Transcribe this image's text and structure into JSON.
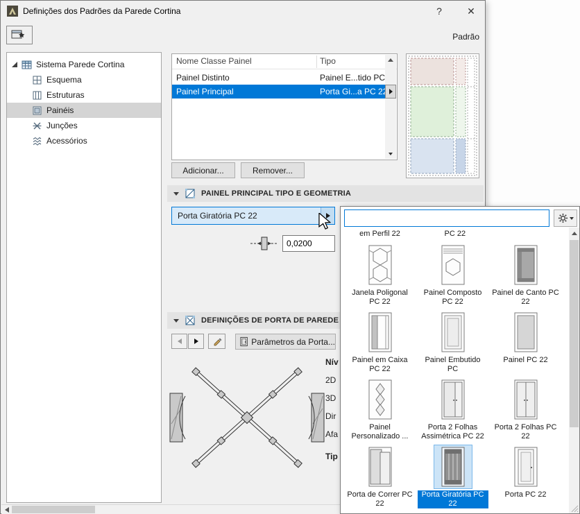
{
  "window": {
    "title": "Definições dos Padrões da Parede Cortina",
    "help_label": "?",
    "close_label": "✕"
  },
  "toolbar": {
    "state_label": "Padrão"
  },
  "sidebar": {
    "root_label": "Sistema Parede Cortina",
    "items": [
      {
        "label": "Esquema"
      },
      {
        "label": "Estruturas"
      },
      {
        "label": "Painéis"
      },
      {
        "label": "Junções"
      },
      {
        "label": "Acessórios"
      }
    ],
    "selected_item": "Painéis"
  },
  "panel_table": {
    "columns": {
      "name": "Nome Classe Painel",
      "type": "Tipo"
    },
    "rows": [
      {
        "name": "Painel Distinto",
        "type": "Painel E...tido PC"
      },
      {
        "name": "Painel Principal",
        "type": "Porta Gi...a PC 22"
      }
    ],
    "selected_row": "Painel Principal",
    "add_label": "Adicionar...",
    "remove_label": "Remover..."
  },
  "geometry_section": {
    "title": "PAINEL PRINCIPAL TIPO E GEOMETRIA",
    "type_value": "Porta Giratória PC 22",
    "thickness_value": "0,0200"
  },
  "door_section": {
    "title": "DEFINIÇÕES DE PORTA DE PAREDE CO",
    "params_button": "Parâmetros da Porta...",
    "clipped_labels": [
      "Nív",
      "2D",
      "3D",
      "Dir",
      "Afa",
      "Tip"
    ]
  },
  "popup": {
    "search_value": "",
    "partial_labels": [
      "em Perfil 22",
      "PC 22"
    ],
    "items": [
      {
        "label": "Janela Poligonal PC 22"
      },
      {
        "label": "Painel Composto PC 22"
      },
      {
        "label": "Painel de Canto PC 22"
      },
      {
        "label": "Painel em Caixa PC 22"
      },
      {
        "label": "Painel Embutido PC"
      },
      {
        "label": "Painel PC 22"
      },
      {
        "label": "Painel Personalizado ..."
      },
      {
        "label": "Porta 2 Folhas Assimétrica PC 22"
      },
      {
        "label": "Porta 2 Folhas PC 22"
      },
      {
        "label": "Porta de Correr PC 22"
      },
      {
        "label": "Porta Giratória PC 22"
      },
      {
        "label": "Porta PC 22"
      }
    ],
    "selected_item": "Porta Giratória PC 22",
    "selected_index": 10
  },
  "colors": {
    "selection_blue": "#0078d7",
    "combo_highlight": "#d8eaf9",
    "tree_selected": "#d4d4d4"
  }
}
